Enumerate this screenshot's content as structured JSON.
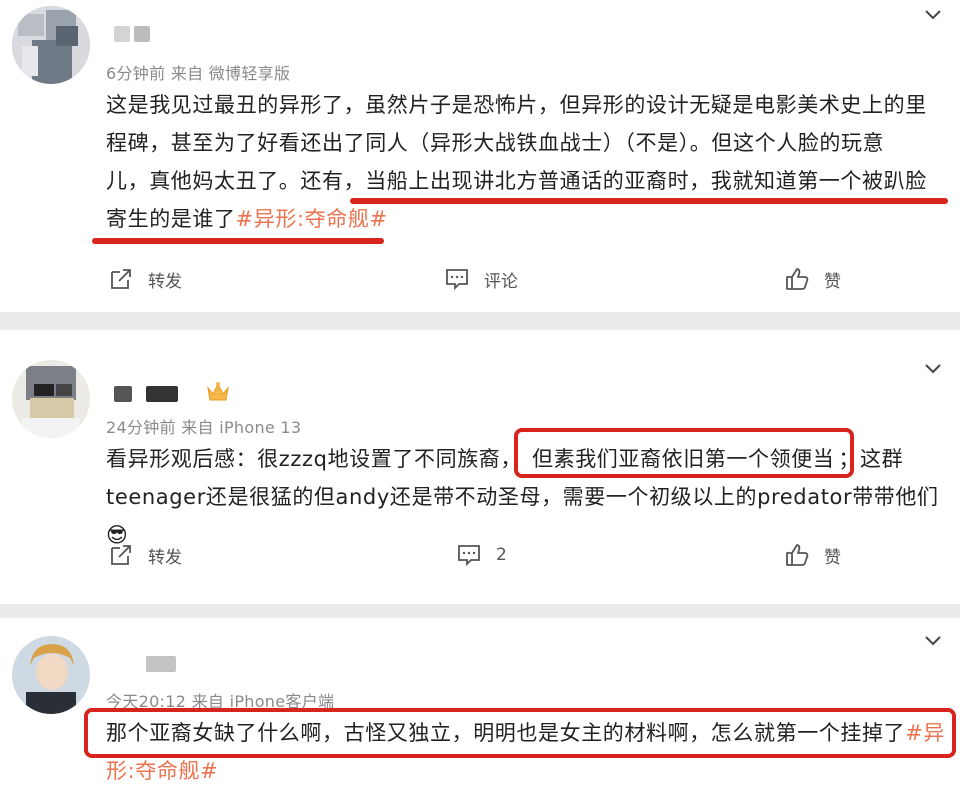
{
  "posts": [
    {
      "meta": "6分钟前 来自 微博轻享版",
      "lines": [
        "这是我见过最丑的异形了，虽然片子是恐怖片，但异形的设计无疑是电影美术史上的里",
        "程碑，甚至为了好看还出了同人（异形大战铁血战士）（不是）。但这个人脸的玩意",
        "儿，真他妈太丑了。还有，当船上出现讲北方普通话的亚裔时，我就知道第一个被趴脸",
        "寄生的是谁了"
      ],
      "topic": "#异形:夺命舰#",
      "actions": {
        "repost": "转发",
        "comment": "评论",
        "like": "赞"
      }
    },
    {
      "meta": "24分钟前 来自 iPhone 13",
      "line1_a": "看异形观后感：很zzzq地设置了不同族裔，",
      "line1_b": "但素我们亚裔依旧第一个领便当",
      "line1_c": "；这群",
      "line2": "teenager还是很猛的但andy还是带不动圣母，需要一个初级以上的predator带带他们",
      "emoji": "😎",
      "actions": {
        "repost": "转发",
        "comment": "2",
        "like": "赞"
      }
    },
    {
      "meta": "今天20:12 来自 iPhone客户端",
      "line1": "那个亚裔女缺了什么啊，古怪又独立，明明也是女主的材料啊，怎么就第一个挂掉了",
      "topic_a": "#异",
      "topic_b": "形:夺命舰#"
    }
  ],
  "icons": [
    "chevron-down-icon",
    "repost-icon",
    "comment-icon",
    "like-icon",
    "crown-icon"
  ],
  "colors": {
    "topic": "#eb7350",
    "highlight": "#d9231d",
    "separator": "#ebebeb"
  }
}
